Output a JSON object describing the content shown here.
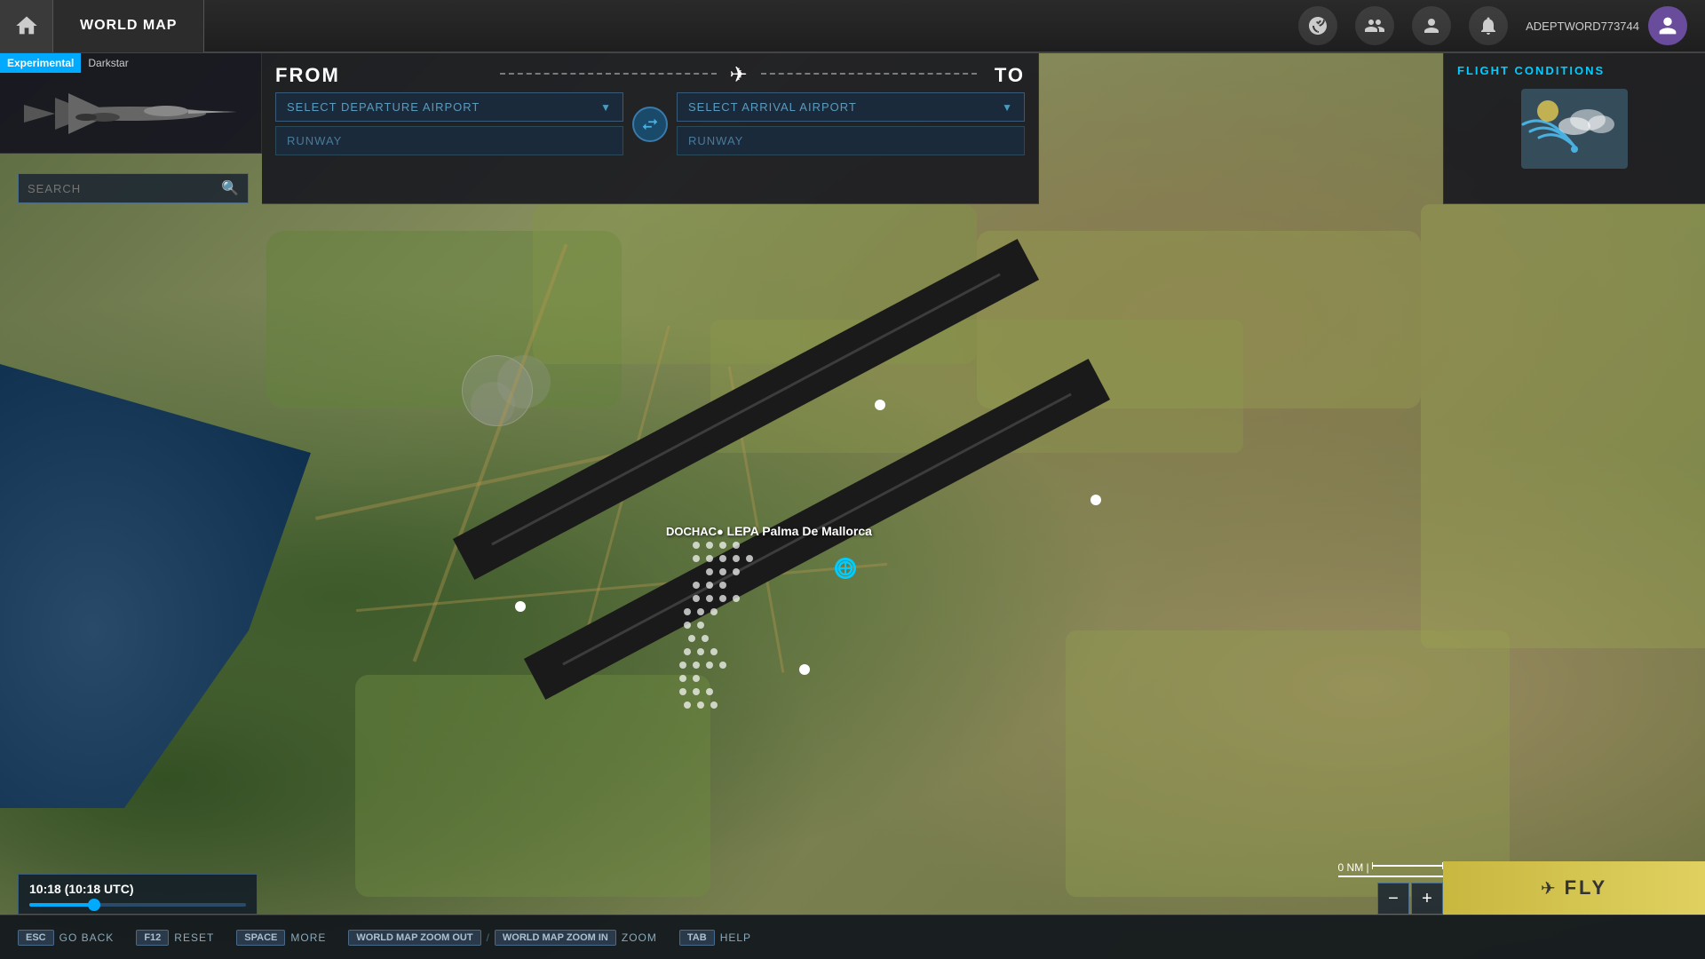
{
  "topbar": {
    "home_label": "⌂",
    "world_map_label": "WORLD MAP",
    "username": "ADEPTWORD773744",
    "icons": {
      "target": "◎",
      "community": "👥",
      "profile": "👤",
      "notifications": "🔔"
    }
  },
  "left_panel": {
    "experimental_label": "Experimental",
    "aircraft_name": "Darkstar"
  },
  "flight_header": {
    "from_label": "FROM",
    "to_label": "TO",
    "departure_placeholder": "SELECT DEPARTURE AIRPORT",
    "arrival_placeholder": "SELECT ARRIVAL AIRPORT",
    "runway_label": "RUNWAY"
  },
  "flight_conditions": {
    "title": "FLIGHT CONDITIONS"
  },
  "search": {
    "placeholder": "SEARCH"
  },
  "map": {
    "airport_name": "LEPA Palma De Mallorca",
    "airport_code": "DOCHAC●",
    "scale": "0 NM |"
  },
  "time": {
    "display": "10:18 (10:18 UTC)"
  },
  "fly_button": {
    "label": "FLY"
  },
  "bottom_bar": {
    "esc": "ESC",
    "go_back": "GO BACK",
    "f12": "F12",
    "reset": "RESET",
    "space": "SPACE",
    "more": "MORE",
    "zoom_out_key": "WORLD MAP ZOOM OUT",
    "slash": "/",
    "zoom_in_key": "WORLD MAP ZOOM IN",
    "zoom_label": "ZOOM",
    "tab": "TAB",
    "help": "HELP"
  }
}
